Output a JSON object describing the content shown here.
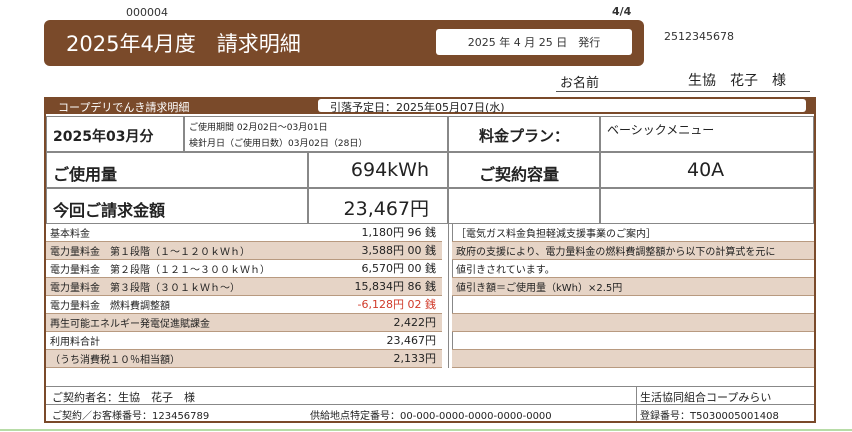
{
  "doc_number": "000004",
  "page_indicator": "4/4",
  "banner": {
    "title": "2025年4月度　請求明細",
    "issue_date": "2025 年 4 月 25 日　発行"
  },
  "account_code": "2512345678",
  "recipient": {
    "label": "お名前",
    "name": "生協　花子　様"
  },
  "section_header": {
    "title": "コープデリでんき請求明細",
    "schedule": "引落予定日：2025年05月07日(水)"
  },
  "summary": {
    "month": "2025年03月分",
    "usage_period": "ご使用期間 02月02日～03月01日",
    "meter_date": "検針月日（ご使用日数）03月02日（28日）",
    "plan_label": "料金プラン：",
    "plan_value": "ベーシックメニュー",
    "usage_label": "ご使用量",
    "usage_value": "694kWh",
    "capacity_label": "ご契約容量",
    "capacity_value": "40A",
    "total_label": "今回ご請求金額",
    "total_value": "23,467円"
  },
  "charges": [
    {
      "label": "基本料金",
      "amount": "1,180円 96 銭",
      "shade": false,
      "red": false
    },
    {
      "label": "電力量料金　第１段階（１～１２０ｋＷｈ）",
      "amount": "3,588円 00 銭",
      "shade": true,
      "red": false
    },
    {
      "label": "電力量料金　第２段階（１２１～３００ｋＷｈ）",
      "amount": "6,570円 00 銭",
      "shade": false,
      "red": false
    },
    {
      "label": "電力量料金　第３段階（３０１ｋＷｈ～）",
      "amount": "15,834円 86 銭",
      "shade": true,
      "red": false
    },
    {
      "label": "電力量料金　燃料費調整額",
      "amount": "-6,128円 02 銭",
      "shade": false,
      "red": true
    },
    {
      "label": "再生可能エネルギー発電促進賦課金",
      "amount": "2,422円",
      "shade": true,
      "red": false
    },
    {
      "label": "利用料合計",
      "amount": "23,467円",
      "shade": false,
      "red": false
    },
    {
      "label": "（うち消費税１０％相当額）",
      "amount": "2,133円",
      "shade": true,
      "red": false
    }
  ],
  "notice": [
    "［電気ガス料金負担軽減支援事業のご案内］",
    "政府の支援により、電力量料金の燃料費調整額から以下の計算式を元に",
    "値引きされています。",
    "値引き額＝ご使用量（kWh）×2.5円"
  ],
  "footer": {
    "contractor": "ご契約者名：生協　花子　様",
    "customer_no": "ご契約／お客様番号：123456789",
    "supply_point": "供給地点特定番号：00-000-0000-0000-0000-0000",
    "org": "生活協同組合コープみらい",
    "reg_no": "登録番号：T5030005001408"
  },
  "colors": {
    "brand": "#7a4a2a",
    "shade": "#e6d4c6",
    "red": "#d03a2a"
  }
}
